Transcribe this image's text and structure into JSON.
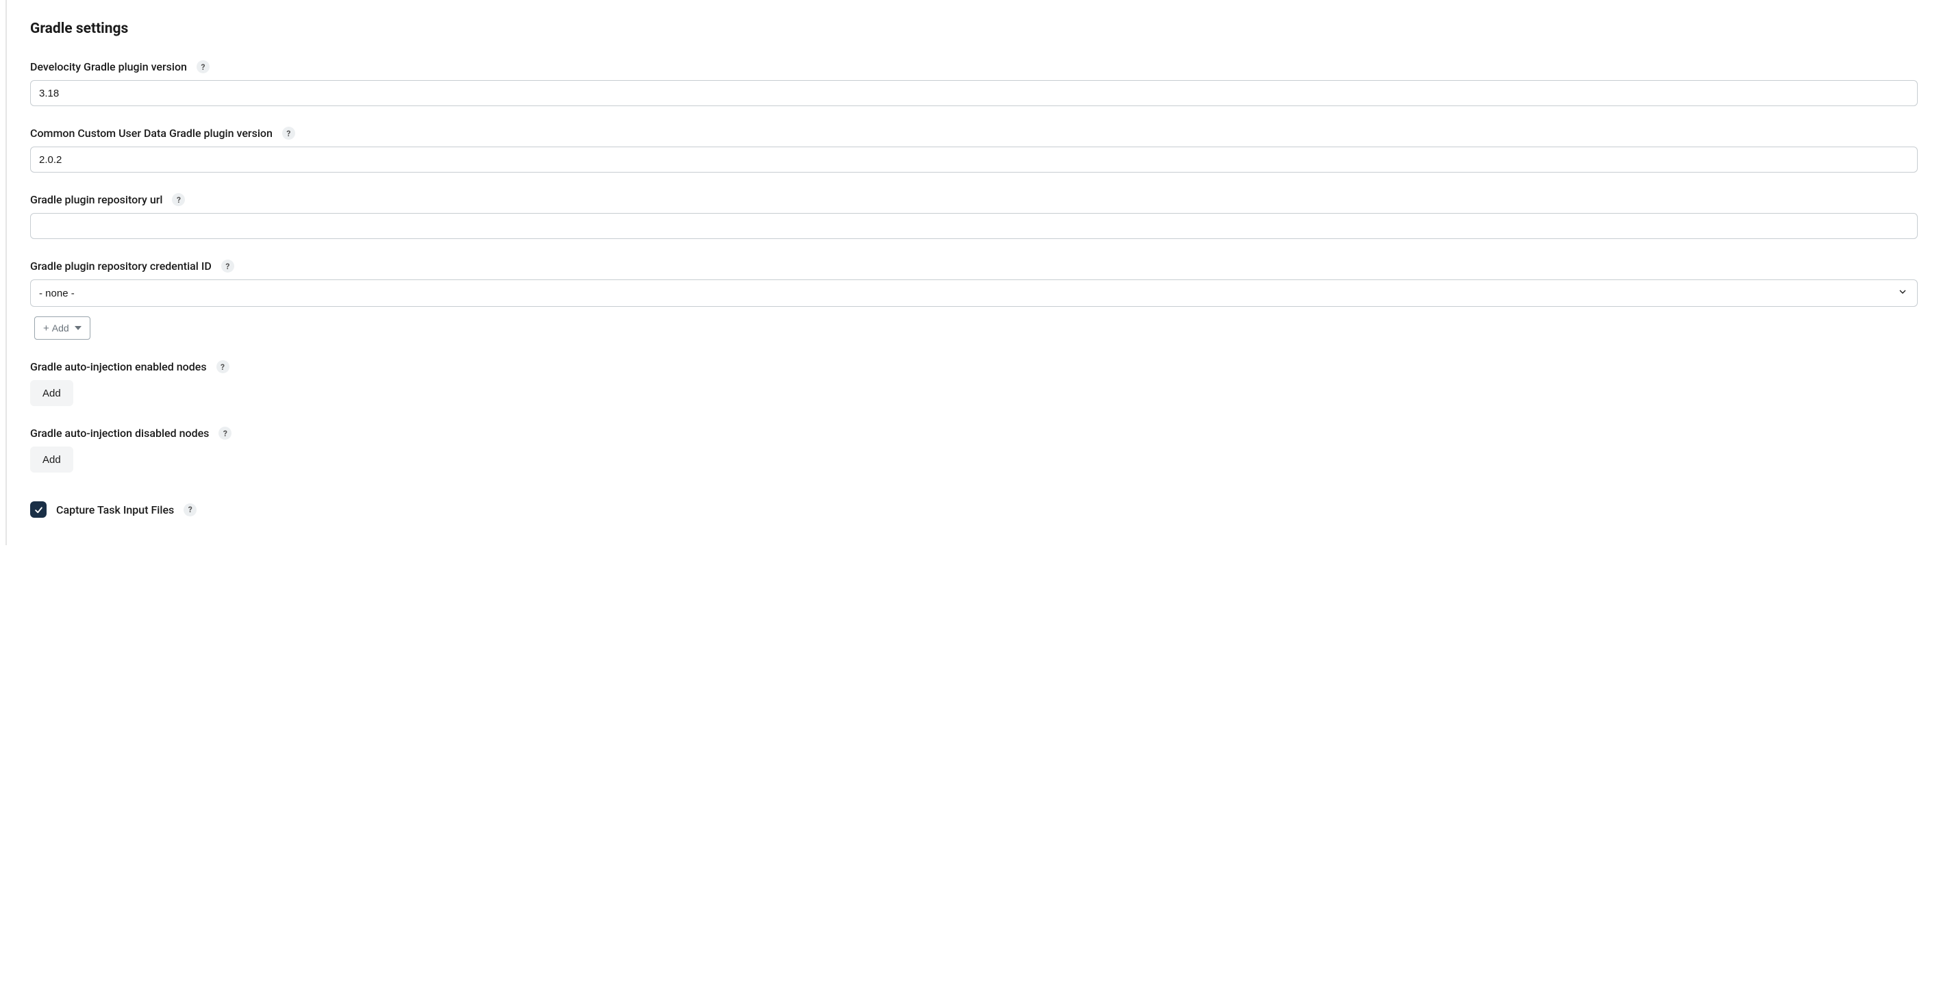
{
  "section": {
    "title": "Gradle settings"
  },
  "fields": {
    "pluginVersion": {
      "label": "Develocity Gradle plugin version",
      "value": "3.18"
    },
    "ccudVersion": {
      "label": "Common Custom User Data Gradle plugin version",
      "value": "2.0.2"
    },
    "repoUrl": {
      "label": "Gradle plugin repository url",
      "value": ""
    },
    "repoCredentialId": {
      "label": "Gradle plugin repository credential ID",
      "selected": "- none -",
      "addLabel": "Add"
    },
    "enabledNodes": {
      "label": "Gradle auto-injection enabled nodes",
      "addLabel": "Add"
    },
    "disabledNodes": {
      "label": "Gradle auto-injection disabled nodes",
      "addLabel": "Add"
    },
    "captureInputs": {
      "label": "Capture Task Input Files",
      "checked": true
    }
  },
  "help": {
    "glyph": "?"
  }
}
